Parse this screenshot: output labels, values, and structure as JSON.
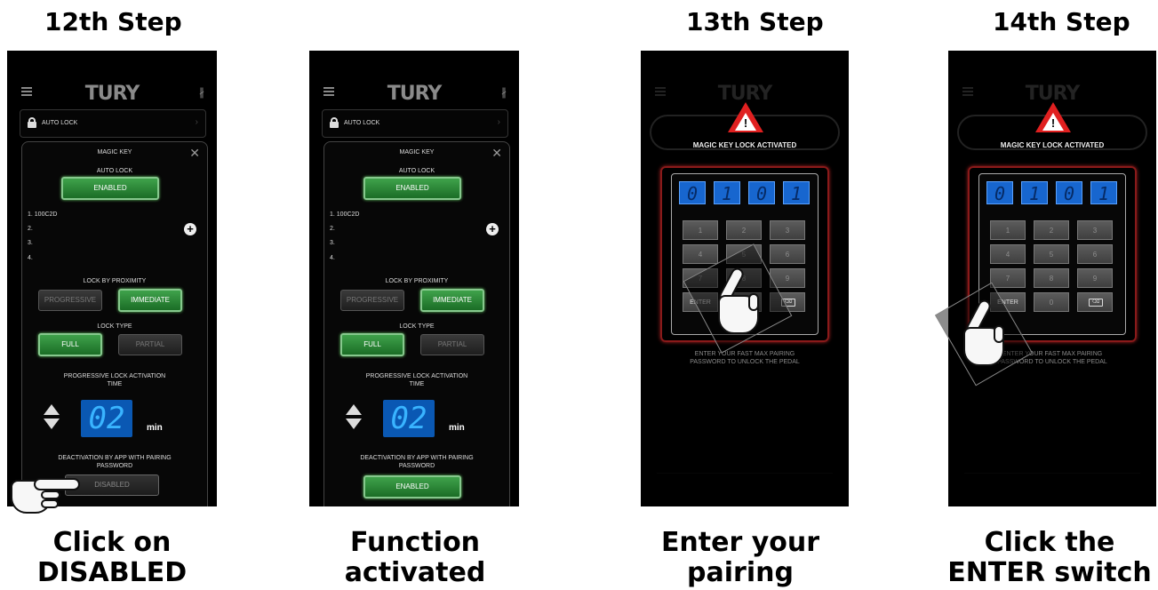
{
  "steps": [
    {
      "title": "12th Step",
      "caption_line1": "Click on",
      "caption_line2": "DISABLED"
    },
    {
      "title": "",
      "caption_line1": "Function",
      "caption_line2": "activated"
    },
    {
      "title": "13th Step",
      "caption_line1": "Enter your",
      "caption_line2": "pairing password"
    },
    {
      "title": "14th Step",
      "caption_line1": "Click the",
      "caption_line2": "ENTER switch"
    }
  ],
  "app": {
    "logo": "TURY",
    "menu_icon": "hamburger-menu-icon",
    "bluetooth_icon": "bluetooth-icon",
    "bluetooth_glyph": "∦",
    "auto_lock_row": "AUTO LOCK",
    "modal": {
      "title": "MAGIC KEY",
      "close_glyph": "✕",
      "auto_lock_label": "AUTO LOCK",
      "auto_lock_state": "ENABLED",
      "keys": [
        "1. 100C2D",
        "2.",
        "3.",
        "4."
      ],
      "add_glyph": "+",
      "proximity_label": "LOCK BY PROXIMITY",
      "proximity_options": [
        "PROGRESSIVE",
        "IMMEDIATE"
      ],
      "proximity_selected": "IMMEDIATE",
      "lock_type_label": "LOCK TYPE",
      "lock_type_options": [
        "FULL",
        "PARTIAL"
      ],
      "lock_type_selected": "FULL",
      "activation_time_line1": "PROGRESSIVE LOCK ACTIVATION",
      "activation_time_line2": "TIME",
      "activation_time_value": "02",
      "activation_time_unit": "min",
      "deactivation_line1": "DEACTIVATION BY APP WITH PAIRING",
      "deactivation_line2": "PASSWORD",
      "deactivation_state_before": "DISABLED",
      "deactivation_state_after": "ENABLED"
    }
  },
  "keypad": {
    "warning_icon": "warning-triangle-icon",
    "warning_mark": "!",
    "title": "MAGIC KEY LOCK ACTIVATED",
    "digits": [
      "0",
      "1",
      "0",
      "1"
    ],
    "keys": [
      "1",
      "2",
      "3",
      "4",
      "5",
      "6",
      "7",
      "8",
      "9",
      "ENTER",
      "0",
      "⌫"
    ],
    "instruction_line1": "ENTER YOUR FAST MAX PAIRING",
    "instruction_line2": "PASSWORD TO UNLOCK THE PEDAL"
  },
  "colors": {
    "enabled_green": "#2e8b3a",
    "digit_blue": "#1766cf",
    "warning_red": "#e02020",
    "keypad_border": "#8a1a1a"
  }
}
